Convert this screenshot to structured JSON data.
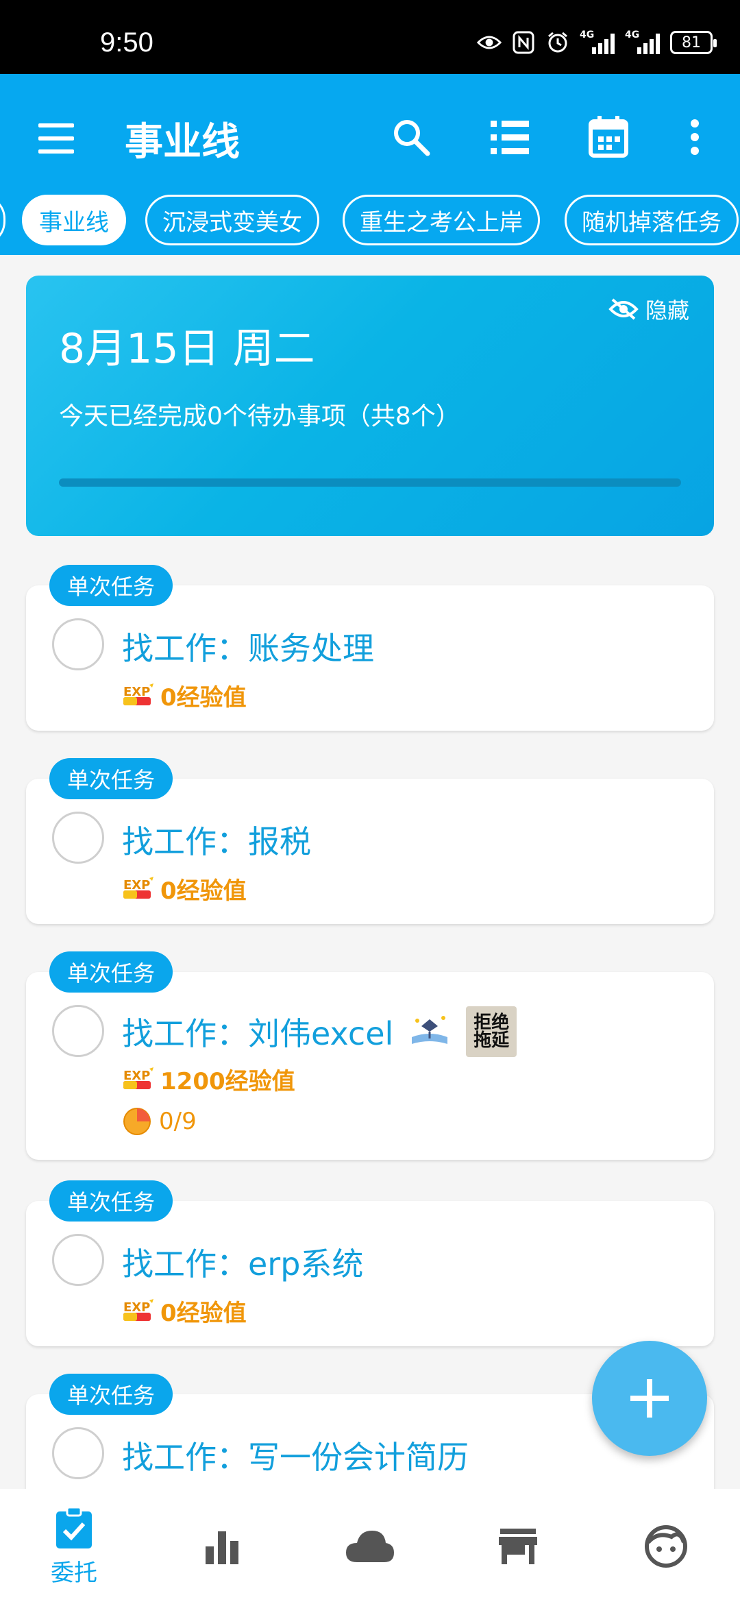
{
  "status_bar": {
    "time": "9:50",
    "network_tag": "4G",
    "battery": "81"
  },
  "app_bar": {
    "title": "事业线",
    "chips": [
      {
        "label": "事业线",
        "active": true
      },
      {
        "label": "沉浸式变美女",
        "active": false
      },
      {
        "label": "重生之考公上岸",
        "active": false
      },
      {
        "label": "随机掉落任务",
        "active": false
      }
    ]
  },
  "summary": {
    "hide_label": "隐藏",
    "date": "8月15日 周二",
    "text": "今天已经完成0个待办事项（共8个）",
    "progress": 0
  },
  "tasks": [
    {
      "badge": "单次任务",
      "title": "找工作：账务处理",
      "exp": "0经验值"
    },
    {
      "badge": "单次任务",
      "title": "找工作：报税",
      "exp": "0经验值"
    },
    {
      "badge": "单次任务",
      "title": "找工作：刘伟excel",
      "exp": "1200经验值",
      "progress": "0/9",
      "sticker_text": "拒绝拖延"
    },
    {
      "badge": "单次任务",
      "title": "找工作：erp系统",
      "exp": "0经验值"
    },
    {
      "badge": "单次任务",
      "title": "找工作：写一份会计简历"
    }
  ],
  "bottom_nav": {
    "items": [
      {
        "label": "委托",
        "icon": "clipboard-check-icon",
        "active": true
      },
      {
        "label": "",
        "icon": "bar-chart-icon"
      },
      {
        "label": "",
        "icon": "cloud-icon"
      },
      {
        "label": "",
        "icon": "store-icon"
      },
      {
        "label": "",
        "icon": "face-icon"
      }
    ]
  },
  "colors": {
    "primary": "#06a8f0",
    "exp": "#f0960a",
    "title": "#129fdc"
  }
}
